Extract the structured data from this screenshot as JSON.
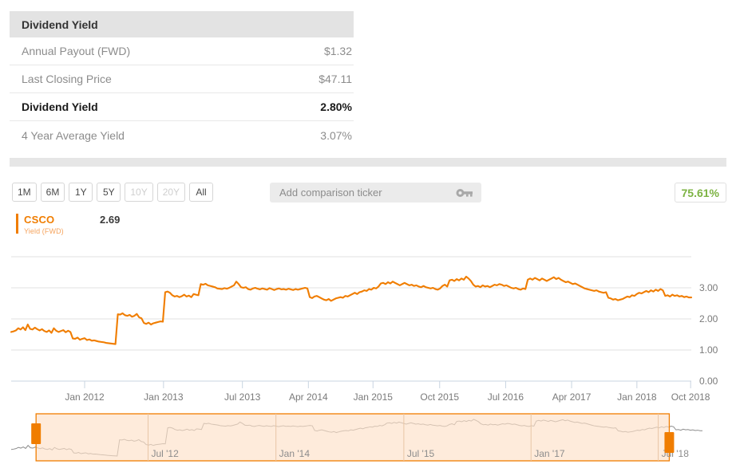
{
  "summary": {
    "title": "Dividend Yield",
    "rows": [
      {
        "label": "Annual Payout (FWD)",
        "value": "$1.32",
        "emphasis": false
      },
      {
        "label": "Last Closing Price",
        "value": "$47.11",
        "emphasis": false
      },
      {
        "label": "Dividend Yield",
        "value": "2.80%",
        "emphasis": true
      },
      {
        "label": "4 Year Average Yield",
        "value": "3.07%",
        "emphasis": false
      }
    ]
  },
  "toolbar": {
    "ranges": [
      {
        "label": "1M",
        "disabled": false
      },
      {
        "label": "6M",
        "disabled": false
      },
      {
        "label": "1Y",
        "disabled": false
      },
      {
        "label": "5Y",
        "disabled": false
      },
      {
        "label": "10Y",
        "disabled": true
      },
      {
        "label": "20Y",
        "disabled": true
      },
      {
        "label": "All",
        "disabled": false
      }
    ],
    "comparison_placeholder": "Add comparison ticker",
    "comparison_value": "",
    "key_icon": "key-icon",
    "percent_change": "75.61%",
    "percent_change_color": "#7cb342"
  },
  "legend": {
    "ticker": "CSCO",
    "subtitle": "Yield (FWD)",
    "value": "2.69",
    "color": "#f07d00"
  },
  "chart_data": {
    "type": "line",
    "title": "",
    "xlabel": "",
    "ylabel": "",
    "series_name": "CSCO Yield (FWD)",
    "series_color": "#f07d00",
    "grid": true,
    "legend_position": "top-left",
    "ylim": [
      0.0,
      4.0
    ],
    "yticks": [
      0.0,
      1.0,
      2.0,
      3.0
    ],
    "ytick_labels": [
      "0.00",
      "1.00",
      "2.00",
      "3.00"
    ],
    "xtick_labels": [
      "Jan 2012",
      "Jan 2013",
      "Jul 2013",
      "Apr 2014",
      "Jan 2015",
      "Oct 2015",
      "Jul 2016",
      "Apr 2017",
      "Jan 2018",
      "Oct 2018"
    ],
    "xtick_positions": [
      0.108,
      0.224,
      0.34,
      0.437,
      0.532,
      0.63,
      0.727,
      0.824,
      0.92,
      0.999
    ],
    "values": [
      1.58,
      1.6,
      1.63,
      1.7,
      1.66,
      1.73,
      1.64,
      1.82,
      1.68,
      1.66,
      1.72,
      1.67,
      1.63,
      1.67,
      1.61,
      1.58,
      1.63,
      1.55,
      1.7,
      1.62,
      1.58,
      1.61,
      1.64,
      1.57,
      1.62,
      1.58,
      1.37,
      1.36,
      1.4,
      1.33,
      1.36,
      1.38,
      1.32,
      1.34,
      1.3,
      1.31,
      1.29,
      1.27,
      1.26,
      1.25,
      1.23,
      1.22,
      1.21,
      1.2,
      1.19,
      2.15,
      2.14,
      2.18,
      2.12,
      2.1,
      2.13,
      2.07,
      2.1,
      2.16,
      2.05,
      2.02,
      1.87,
      1.84,
      1.88,
      1.82,
      1.86,
      1.88,
      1.9,
      1.92,
      1.91,
      2.86,
      2.88,
      2.84,
      2.76,
      2.72,
      2.74,
      2.7,
      2.73,
      2.78,
      2.72,
      2.75,
      2.7,
      2.8,
      2.78,
      2.76,
      3.12,
      3.1,
      3.13,
      3.08,
      3.06,
      3.04,
      3.02,
      2.98,
      2.97,
      2.96,
      2.99,
      2.97,
      3.0,
      3.04,
      3.08,
      3.2,
      3.12,
      3.02,
      3.0,
      3.02,
      2.96,
      2.94,
      2.98,
      3.0,
      2.97,
      2.95,
      2.98,
      2.96,
      2.94,
      2.99,
      2.96,
      2.93,
      2.96,
      2.98,
      2.95,
      2.96,
      2.94,
      2.97,
      2.95,
      2.93,
      2.96,
      2.94,
      2.96,
      2.98,
      3.0,
      2.98,
      2.7,
      2.67,
      2.72,
      2.74,
      2.7,
      2.66,
      2.62,
      2.6,
      2.64,
      2.58,
      2.62,
      2.66,
      2.68,
      2.7,
      2.68,
      2.74,
      2.72,
      2.76,
      2.8,
      2.84,
      2.8,
      2.86,
      2.88,
      2.92,
      2.9,
      2.96,
      2.94,
      3.0,
      2.98,
      3.04,
      3.14,
      3.16,
      3.12,
      3.18,
      3.14,
      3.2,
      3.16,
      3.12,
      3.08,
      3.12,
      3.16,
      3.12,
      3.08,
      3.1,
      3.06,
      3.08,
      3.04,
      3.02,
      3.06,
      3.02,
      3.0,
      2.98,
      3.0,
      2.96,
      2.94,
      2.98,
      3.06,
      3.1,
      3.04,
      3.24,
      3.26,
      3.22,
      3.28,
      3.24,
      3.3,
      3.26,
      3.36,
      3.3,
      3.22,
      3.1,
      3.04,
      3.06,
      3.02,
      3.08,
      3.04,
      3.06,
      3.02,
      3.06,
      3.1,
      3.08,
      3.12,
      3.1,
      3.06,
      3.08,
      3.04,
      3.0,
      2.98,
      3.0,
      2.96,
      2.94,
      2.98,
      2.96,
      3.26,
      3.3,
      3.26,
      3.32,
      3.28,
      3.24,
      3.3,
      3.26,
      3.22,
      3.26,
      3.3,
      3.34,
      3.28,
      3.32,
      3.26,
      3.22,
      3.18,
      3.2,
      3.16,
      3.12,
      3.14,
      3.1,
      3.06,
      3.02,
      2.98,
      2.96,
      2.94,
      2.92,
      2.9,
      2.92,
      2.88,
      2.86,
      2.84,
      2.86,
      2.68,
      2.66,
      2.62,
      2.64,
      2.6,
      2.62,
      2.64,
      2.68,
      2.72,
      2.7,
      2.76,
      2.74,
      2.8,
      2.84,
      2.82,
      2.86,
      2.9,
      2.86,
      2.92,
      2.88,
      2.94,
      2.9,
      2.96,
      2.92,
      2.74,
      2.76,
      2.72,
      2.78,
      2.74,
      2.76,
      2.72,
      2.74,
      2.7,
      2.72,
      2.69,
      2.69
    ]
  },
  "navigator": {
    "xtick_labels": [
      "Jul '12",
      "Jan '14",
      "Jul '15",
      "Jan '17",
      "Jul '18"
    ],
    "xtick_positions": [
      0.198,
      0.383,
      0.568,
      0.752,
      0.936
    ],
    "selection_start": 0.036,
    "selection_end": 0.952,
    "fill_color": "#fde1c8",
    "line_color": "#8c8c8c",
    "handle_color": "#f07d00"
  }
}
